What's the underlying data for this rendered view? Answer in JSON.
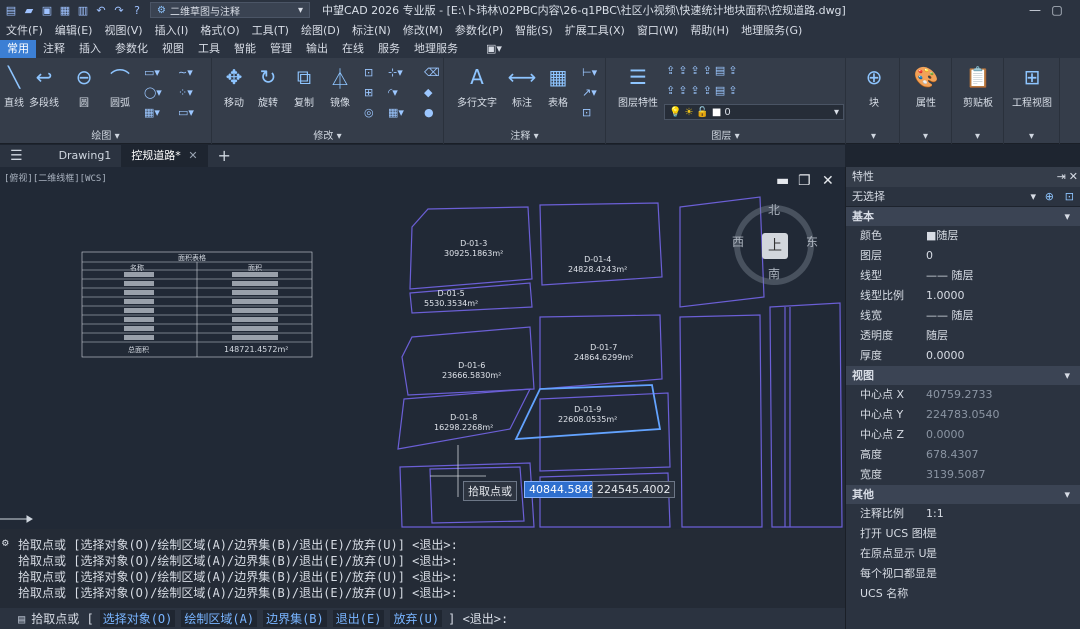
{
  "app": {
    "workspace": "二维草图与注释",
    "title": "中望CAD 2026 专业版 - [E:\\卜玮林\\02PBC内容\\26-q1PBC\\社区小视频\\快速统计地块面积\\控规道路.dwg]"
  },
  "menu": [
    "文件(F)",
    "编辑(E)",
    "视图(V)",
    "插入(I)",
    "格式(O)",
    "工具(T)",
    "绘图(D)",
    "标注(N)",
    "修改(M)",
    "参数化(P)",
    "智能(S)",
    "扩展工具(X)",
    "窗口(W)",
    "帮助(H)",
    "地理服务(G)"
  ],
  "ribbon_tabs": [
    "常用",
    "注释",
    "插入",
    "参数化",
    "视图",
    "工具",
    "智能",
    "管理",
    "输出",
    "在线",
    "服务",
    "地理服务"
  ],
  "ribbon": {
    "draw": {
      "label": "绘图 ▾",
      "items": [
        "直线",
        "多段线",
        "圆",
        "圆弧"
      ]
    },
    "modify": {
      "label": "修改 ▾",
      "items": [
        "移动",
        "旋转",
        "复制",
        "镜像"
      ]
    },
    "annotate": {
      "label": "注释 ▾",
      "items": [
        "多行文字",
        "标注",
        "表格"
      ]
    },
    "layer": {
      "label": "图层 ▾",
      "props_label": "图层特性",
      "current": "0"
    },
    "right": [
      "块",
      "属性",
      "剪贴板",
      "工程视图"
    ]
  },
  "doc_tabs": [
    "Drawing1",
    "控规道路*"
  ],
  "viewport_label": "[俯视][二维线框][WCS]",
  "viewcube": {
    "n": "北",
    "s": "南",
    "e": "东",
    "w": "西",
    "top": "上"
  },
  "table": {
    "title": "面积表格",
    "headers": [
      "名称",
      "面积"
    ],
    "total_label": "总面积",
    "total_value": "148721.4572m²"
  },
  "parcels": [
    {
      "name": "D-01-3",
      "area": "30925.1863m²"
    },
    {
      "name": "D-01-4",
      "area": "24828.4243m²"
    },
    {
      "name": "D-01-5",
      "area": "5530.3534m²"
    },
    {
      "name": "D-01-6",
      "area": "23666.5830m²"
    },
    {
      "name": "D-01-7",
      "area": "24864.6299m²"
    },
    {
      "name": "D-01-8",
      "area": "16298.2268m²"
    },
    {
      "name": "D-01-9",
      "area": "22608.0535m²"
    }
  ],
  "cursor": {
    "prompt": "拾取点或",
    "x": "40844.5849",
    "y": "224545.4002"
  },
  "cmd_history": [
    "拾取点或 [选择对象(O)/绘制区域(A)/边界集(B)/退出(E)/放弃(U)] <退出>:",
    "拾取点或 [选择对象(O)/绘制区域(A)/边界集(B)/退出(E)/放弃(U)] <退出>:",
    "拾取点或 [选择对象(O)/绘制区域(A)/边界集(B)/退出(E)/放弃(U)] <退出>:",
    "拾取点或 [选择对象(O)/绘制区域(A)/边界集(B)/退出(E)/放弃(U)] <退出>:"
  ],
  "cmdline": {
    "lead": "拾取点或 [",
    "o": "选择对象(O)",
    "a": "绘制区域(A)",
    "b": "边界集(B)",
    "e": "退出(E)",
    "u": "放弃(U)",
    "tail": "] <退出>:"
  },
  "props": {
    "title": "特性",
    "selection": "无选择",
    "sec_basic": "基本",
    "basic": [
      [
        "颜色",
        "■随层"
      ],
      [
        "图层",
        "0"
      ],
      [
        "线型",
        "—— 随层"
      ],
      [
        "线型比例",
        "1.0000"
      ],
      [
        "线宽",
        "—— 随层"
      ],
      [
        "透明度",
        "随层"
      ],
      [
        "厚度",
        "0.0000"
      ]
    ],
    "sec_view": "视图",
    "view": [
      [
        "中心点 X",
        "40759.2733"
      ],
      [
        "中心点 Y",
        "224783.0540"
      ],
      [
        "中心点 Z",
        "0.0000"
      ],
      [
        "高度",
        "678.4307"
      ],
      [
        "宽度",
        "3139.5087"
      ]
    ],
    "sec_other": "其他",
    "other": [
      [
        "注释比例",
        "1:1"
      ],
      [
        "打开 UCS 图标",
        "是"
      ],
      [
        "在原点显示 U...",
        "是"
      ],
      [
        "每个视口都显...",
        "是"
      ],
      [
        "UCS 名称",
        ""
      ]
    ]
  }
}
